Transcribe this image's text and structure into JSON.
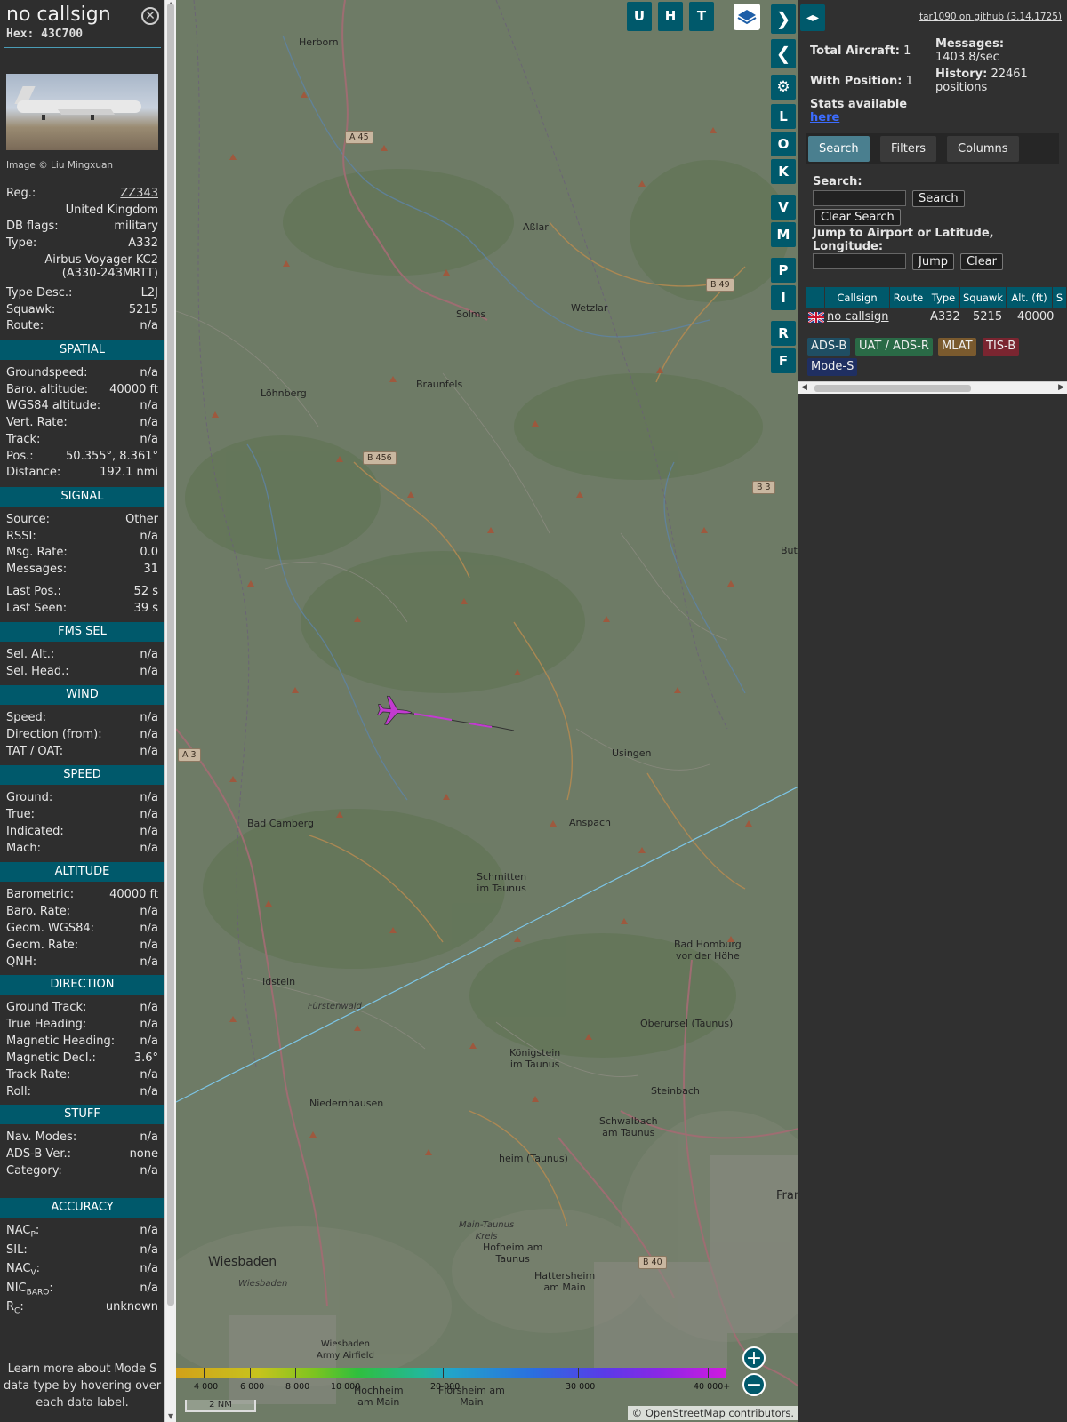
{
  "info": {
    "callsign": "no callsign",
    "hex_label": "Hex:",
    "hex": "43C700",
    "close_icon": "close-icon",
    "image_credit": "Image © Liu Mingxuan",
    "general": [
      {
        "label": "Reg.:",
        "value": "ZZ343",
        "link": true
      },
      {
        "label": "",
        "value": "United Kingdom"
      },
      {
        "label": "DB flags:",
        "value": "military"
      },
      {
        "label": "Type:",
        "value": "A332"
      },
      {
        "label": "",
        "value": "Airbus Voyager KC2"
      },
      {
        "label": "",
        "value": "(A330-243MRTT)"
      },
      {
        "label": "Type Desc.:",
        "value": "L2J"
      },
      {
        "label": "Squawk:",
        "value": "5215"
      },
      {
        "label": "Route:",
        "value": "n/a"
      }
    ],
    "sections": {
      "spatial": "SPATIAL",
      "signal": "SIGNAL",
      "fms": "FMS SEL",
      "wind": "WIND",
      "speed": "SPEED",
      "altitude": "ALTITUDE",
      "direction": "DIRECTION",
      "stuff": "STUFF",
      "accuracy": "ACCURACY"
    },
    "spatial": [
      {
        "label": "Groundspeed:",
        "value": "n/a"
      },
      {
        "label": "Baro. altitude:",
        "value": "40000 ft"
      },
      {
        "label": "WGS84 altitude:",
        "value": "n/a"
      },
      {
        "label": "Vert. Rate:",
        "value": "n/a"
      },
      {
        "label": "Track:",
        "value": "n/a"
      },
      {
        "label": "Pos.:",
        "value": "50.355°, 8.361°"
      },
      {
        "label": "Distance:",
        "value": "192.1 nmi"
      }
    ],
    "signal": [
      {
        "label": "Source:",
        "value": "Other"
      },
      {
        "label": "RSSI:",
        "value": "n/a"
      },
      {
        "label": "Msg. Rate:",
        "value": "0.0"
      },
      {
        "label": "Messages:",
        "value": "31"
      },
      {
        "label": "Last Pos.:",
        "value": "52 s"
      },
      {
        "label": "Last Seen:",
        "value": "39 s"
      }
    ],
    "fms": [
      {
        "label": "Sel. Alt.:",
        "value": "n/a"
      },
      {
        "label": "Sel. Head.:",
        "value": "n/a"
      }
    ],
    "wind": [
      {
        "label": "Speed:",
        "value": "n/a"
      },
      {
        "label": "Direction (from):",
        "value": "n/a"
      },
      {
        "label": "TAT / OAT:",
        "value": "n/a"
      }
    ],
    "speed": [
      {
        "label": "Ground:",
        "value": "n/a"
      },
      {
        "label": "True:",
        "value": "n/a"
      },
      {
        "label": "Indicated:",
        "value": "n/a"
      },
      {
        "label": "Mach:",
        "value": "n/a"
      }
    ],
    "altitude": [
      {
        "label": "Barometric:",
        "value": "40000 ft"
      },
      {
        "label": "Baro. Rate:",
        "value": "n/a"
      },
      {
        "label": "Geom. WGS84:",
        "value": "n/a"
      },
      {
        "label": "Geom. Rate:",
        "value": "n/a"
      },
      {
        "label": "QNH:",
        "value": "n/a"
      }
    ],
    "direction": [
      {
        "label": "Ground Track:",
        "value": "n/a"
      },
      {
        "label": "True Heading:",
        "value": "n/a"
      },
      {
        "label": "Magnetic Heading:",
        "value": "n/a"
      },
      {
        "label": "Magnetic Decl.:",
        "value": "3.6°"
      },
      {
        "label": "Track Rate:",
        "value": "n/a"
      },
      {
        "label": "Roll:",
        "value": "n/a"
      }
    ],
    "stuff": [
      {
        "label": "Nav. Modes:",
        "value": "n/a"
      },
      {
        "label": "ADS-B Ver.:",
        "value": "none"
      },
      {
        "label": "Category:",
        "value": "n/a"
      }
    ],
    "accuracy": [
      {
        "label": "NAC",
        "sub": "P",
        "value": "n/a"
      },
      {
        "label": "SIL:",
        "sub": "",
        "value": "n/a"
      },
      {
        "label": "NAC",
        "sub": "V",
        "value": "n/a"
      },
      {
        "label": "NIC",
        "sub": "BARO",
        "value": "n/a"
      },
      {
        "label": "R",
        "sub": "C",
        "value": "unknown"
      }
    ],
    "footer": [
      "Learn more about Mode S",
      "data type by hovering over",
      "each data label."
    ]
  },
  "map": {
    "buttons_top": [
      "U",
      "H",
      "T"
    ],
    "buttons_side": [
      "L",
      "O",
      "K",
      "V",
      "M",
      "P",
      "I",
      "R",
      "F"
    ],
    "places": {
      "herborn": "Herborn",
      "asslar": "Aßlar",
      "wetzlar": "Wetzlar",
      "solms": "Solms",
      "lohnberg": "Löhnberg",
      "braunfels": "Braunfels",
      "usingen": "Usingen",
      "bad_camberg": "Bad Camberg",
      "anspach": "Anspach",
      "schmitten": "Schmitten\nim Taunus",
      "bad_homburg": "Bad Homburg\nvor der Höhe",
      "idstein": "Idstein",
      "fuerstenwald": "Fürstenwald",
      "oberursel": "Oberursel (Taunus)",
      "koenigstein": "Königstein\nim Taunus",
      "niedernhausen": "Niedernhausen",
      "steinbach": "Steinbach",
      "schwalbach": "Schwalbach\nam Taunus",
      "eppstein": "heim (Taunus)",
      "main_taunus": "Main-Taunus\nKreis",
      "hofheim": "Hofheim am\nTaunus",
      "hattersheim": "Hattersheim\nam Main",
      "wiesbaden": "Wiesbaden",
      "wiesbaden_small": "Wiesbaden",
      "wiesbaden_airfield": "Wiesbaden\nArmy Airfield",
      "hochheim": "Hochheim\nam Main",
      "floersheim": "Flörsheim am\nMain",
      "but": "But",
      "fran": "Fran"
    },
    "roads": {
      "a45": "A 45",
      "b49": "B 49",
      "b456": "B 456",
      "b3": "B 3",
      "a3": "A 3",
      "b40": "B 40"
    },
    "alt_labels": [
      "4 000",
      "6 000",
      "8 000",
      "10 000",
      "20 000",
      "30 000",
      "40 000+"
    ],
    "scale": "2 NM",
    "attribution": "© OpenStreetMap contributors."
  },
  "side": {
    "github_link": "tar1090 on github (3.14.1725)",
    "total_aircraft_label": "Total Aircraft:",
    "total_aircraft": "1",
    "with_position_label": "With Position:",
    "with_position": "1",
    "messages_label": "Messages:",
    "messages_rate": "1403.8/sec",
    "history_label": "History:",
    "history_value": "22461",
    "history_unit": "positions",
    "stats_label": "Stats available",
    "stats_link": "here",
    "tabs": [
      "Search",
      "Filters",
      "Columns"
    ],
    "search_label": "Search:",
    "search_value": "",
    "search_button": "Search",
    "clear_search_button": "Clear Search",
    "jump_label": "Jump to Airport or Latitude, Longitude:",
    "jump_value": "",
    "jump_button": "Jump",
    "clear_button": "Clear",
    "columns": [
      "Callsign",
      "Route",
      "Type",
      "Squawk",
      "Alt. (ft)",
      "S"
    ],
    "row": {
      "callsign": "no callsign",
      "route": "",
      "type": "A332",
      "squawk": "5215",
      "alt": "40000"
    },
    "sources": [
      {
        "label": "ADS-B",
        "color": "#1f4e63"
      },
      {
        "label": "UAT / ADS-R",
        "color": "#2a6a46"
      },
      {
        "label": "MLAT",
        "color": "#7a5a2e"
      },
      {
        "label": "TIS-B",
        "color": "#7a2530"
      },
      {
        "label": "Mode-S",
        "color": "#1f2f62"
      }
    ]
  }
}
